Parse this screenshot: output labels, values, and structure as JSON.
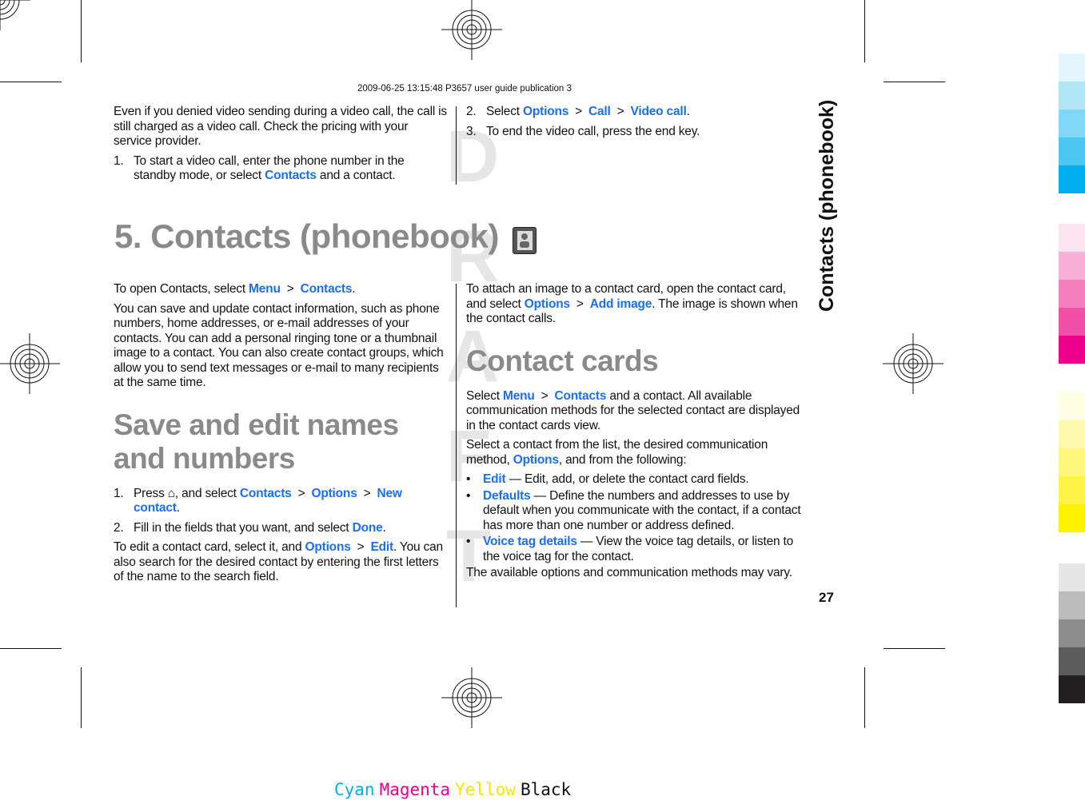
{
  "header": "2009-06-25 13:15:48 P3657 user guide publication 3",
  "watermark": [
    "D",
    "R",
    "A",
    "F",
    "T"
  ],
  "chapter_title": "5.  Contacts (phonebook)",
  "chapter_icon": "contacts-book-icon",
  "side_tab": "Contacts (phonebook)",
  "page_number": "27",
  "link_color": "#1a6ff0",
  "heading_color": "#8a8a8a",
  "top_left": [
    {
      "type": "p",
      "segs": [
        {
          "t": "Even if you denied video sending during a video call, the call is still charged as a video call. Check the pricing with your service provider."
        }
      ]
    },
    {
      "type": "li",
      "n": "1.",
      "segs": [
        {
          "t": "To start a video call, enter the phone number in the standby mode, or select "
        },
        {
          "t": "Contacts",
          "link": true
        },
        {
          "t": " and a contact."
        }
      ]
    }
  ],
  "top_right": [
    {
      "type": "li",
      "n": "2.",
      "segs": [
        {
          "t": "Select "
        },
        {
          "t": "Options",
          "link": true
        },
        {
          "t": ">",
          "sep": true
        },
        {
          "t": "Call",
          "link": true
        },
        {
          "t": ">",
          "sep": true
        },
        {
          "t": "Video call",
          "link": true
        },
        {
          "t": "."
        }
      ]
    },
    {
      "type": "li",
      "n": "3.",
      "segs": [
        {
          "t": "To end the video call, press the end key."
        }
      ]
    }
  ],
  "left": [
    {
      "type": "p",
      "segs": [
        {
          "t": "To open Contacts, select "
        },
        {
          "t": "Menu",
          "link": true
        },
        {
          "t": ">",
          "sep": true
        },
        {
          "t": "Contacts",
          "link": true
        },
        {
          "t": "."
        }
      ]
    },
    {
      "type": "p",
      "segs": [
        {
          "t": "You can save and update contact information, such as phone numbers, home addresses, or e-mail addresses of your contacts. You can add a personal ringing tone or a thumbnail image to a contact. You can also create contact groups, which allow you to send text messages or e-mail to many recipients at the same time."
        }
      ]
    },
    {
      "type": "h2",
      "segs": [
        {
          "t": "Save and edit names and numbers"
        }
      ]
    },
    {
      "type": "li",
      "n": "1.",
      "segs": [
        {
          "t": "Press "
        },
        {
          "t": "⌂",
          "icon": "home-key-icon"
        },
        {
          "t": ", and select "
        },
        {
          "t": "Contacts",
          "link": true
        },
        {
          "t": ">",
          "sep": true
        },
        {
          "t": "Options",
          "link": true
        },
        {
          "t": ">",
          "sep": true
        },
        {
          "t": "New contact",
          "link": true
        },
        {
          "t": "."
        }
      ]
    },
    {
      "type": "li",
      "n": "2.",
      "segs": [
        {
          "t": "Fill in the fields that you want, and select "
        },
        {
          "t": "Done",
          "link": true
        },
        {
          "t": "."
        }
      ]
    },
    {
      "type": "p",
      "segs": [
        {
          "t": "To edit a contact card, select it, and "
        },
        {
          "t": "Options",
          "link": true
        },
        {
          "t": ">",
          "sep": true
        },
        {
          "t": "Edit",
          "link": true
        },
        {
          "t": ". You can also search for the desired contact by entering the first letters of the name to the search field."
        }
      ]
    }
  ],
  "right": [
    {
      "type": "p",
      "segs": [
        {
          "t": "To attach an image to a contact card, open the contact card, and select "
        },
        {
          "t": "Options",
          "link": true
        },
        {
          "t": ">",
          "sep": true
        },
        {
          "t": "Add image",
          "link": true
        },
        {
          "t": ". The image is shown when the contact calls."
        }
      ]
    },
    {
      "type": "h2",
      "segs": [
        {
          "t": "Contact cards"
        }
      ]
    },
    {
      "type": "p",
      "segs": [
        {
          "t": "Select "
        },
        {
          "t": "Menu",
          "link": true
        },
        {
          "t": ">",
          "sep": true
        },
        {
          "t": "Contacts",
          "link": true
        },
        {
          "t": " and a contact. All available communication methods for the selected contact are displayed in the contact cards view."
        }
      ]
    },
    {
      "type": "p",
      "segs": [
        {
          "t": "Select a contact from the list, the desired communication method, "
        },
        {
          "t": "Options",
          "link": true
        },
        {
          "t": ", and from the following:"
        }
      ]
    },
    {
      "type": "bl",
      "n": "•",
      "segs": [
        {
          "t": "Edit",
          "link": true
        },
        {
          "t": "  — Edit, add, or delete the contact card fields."
        }
      ]
    },
    {
      "type": "bl",
      "n": "•",
      "segs": [
        {
          "t": "Defaults",
          "link": true
        },
        {
          "t": "  — Define the numbers and addresses to use by default when you communicate with the contact, if a contact has more than one number or address defined."
        }
      ]
    },
    {
      "type": "bl",
      "n": "•",
      "segs": [
        {
          "t": "Voice tag details",
          "link": true
        },
        {
          "t": " — View the voice tag details, or listen to the voice tag for the contact."
        }
      ]
    },
    {
      "type": "p",
      "segs": [
        {
          "t": "The available options and communication methods may vary."
        }
      ]
    }
  ],
  "swatches": {
    "cyan": [
      "#e3f6fd",
      "#b3e7f8",
      "#82d6f6",
      "#4fc6f1",
      "#00aeef"
    ],
    "magenta": [
      "#fce3f0",
      "#f8b0d7",
      "#f580c0",
      "#f24fa9",
      "#ec008c"
    ],
    "yellow": [
      "#fffde2",
      "#fff9b0",
      "#fff67d",
      "#fff34a",
      "#fff200"
    ],
    "black": [
      "#e6e6e6",
      "#bcbcbc",
      "#8d8d8d",
      "#5c5c5c",
      "#231f20"
    ]
  },
  "color_bar": [
    {
      "label": "Cyan",
      "color": "#00aeef"
    },
    {
      "label": "Magenta",
      "color": "#ec008c"
    },
    {
      "label": "Yellow",
      "color": "#f2e600"
    },
    {
      "label": "Black",
      "color": "#111111"
    }
  ]
}
